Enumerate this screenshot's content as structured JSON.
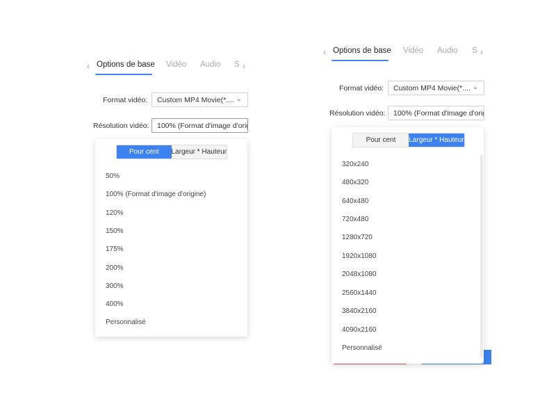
{
  "left": {
    "tabs": {
      "prev_icon": "chevron-left-icon",
      "next_icon": "chevron-right-icon",
      "items": [
        "Options de base",
        "Vidéo",
        "Audio",
        "S"
      ]
    },
    "format_label": "Format vidéo:",
    "format_value": "Custom MP4 Movie(*....",
    "resolution_label": "Résolution vidéo:",
    "resolution_value": "100% (Format d'image d'orig",
    "segment": {
      "percent": "Pour cent",
      "size": "Largeur * Hauteur",
      "active": "percent"
    },
    "options": [
      "50%",
      "100% (Format d'image d'origine)",
      "120%",
      "150%",
      "175%",
      "200%",
      "300%",
      "400%",
      "Personnalisé"
    ]
  },
  "right": {
    "tabs": {
      "prev_icon": "chevron-left-icon",
      "next_icon": "chevron-right-icon",
      "items": [
        "Options de base",
        "Vidéo",
        "Audio",
        "S"
      ]
    },
    "format_label": "Format vidéo:",
    "format_value": "Custom MP4 Movie(*....",
    "resolution_label": "Résolution vidéo:",
    "resolution_value": "100% (Format d'image d'origi",
    "segment": {
      "percent": "Pour cent",
      "size": "Largeur * Hauteur",
      "active": "size"
    },
    "options": [
      "320x240",
      "480x320",
      "640x480",
      "720x480",
      "1280x720",
      "1920x1080",
      "2048x1080",
      "2560x1440",
      "3840x2160",
      "4090x2160",
      "Personnalisé"
    ]
  },
  "colors": {
    "accent": "#3c82f0",
    "danger": "#e05a5a"
  }
}
